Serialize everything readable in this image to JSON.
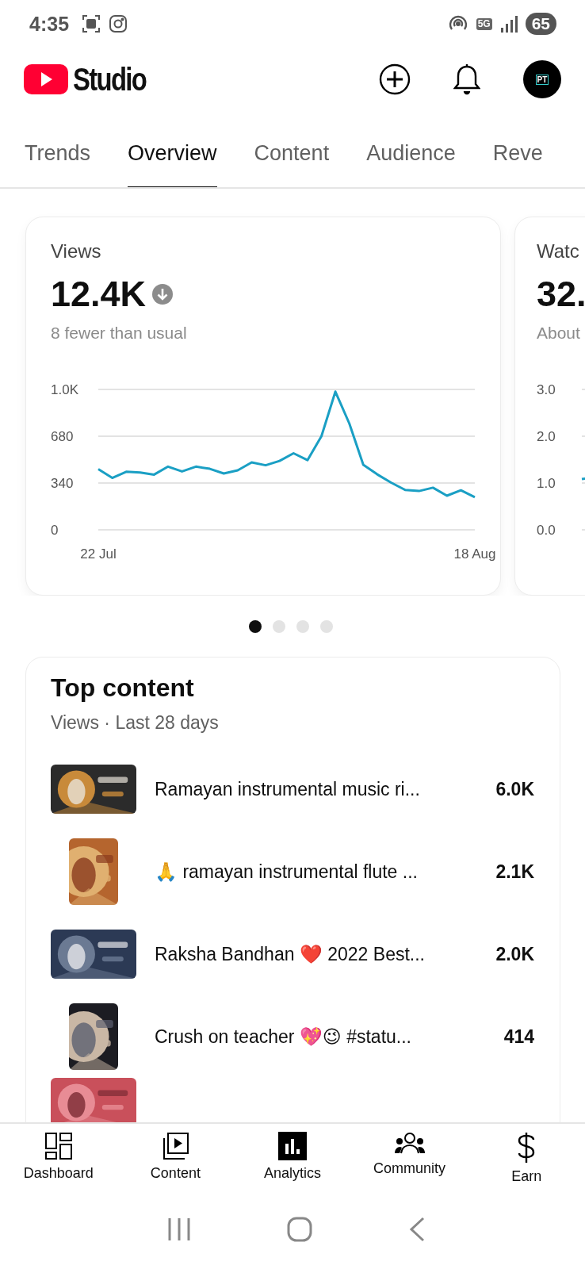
{
  "status_bar": {
    "time": "4:35",
    "network": "5G",
    "battery": "65"
  },
  "header": {
    "app_name": "Studio",
    "avatar_initials": "PT"
  },
  "tabs": [
    {
      "label": "Trends",
      "selected": false
    },
    {
      "label": "Overview",
      "selected": true
    },
    {
      "label": "Content",
      "selected": false
    },
    {
      "label": "Audience",
      "selected": false
    },
    {
      "label": "Reve",
      "selected": false
    }
  ],
  "metric_cards": [
    {
      "kind": "chart",
      "title": "Views",
      "value": "12.4K",
      "comparison": "8 fewer than usual",
      "chart_data": {
        "type": "line",
        "ylim": [
          0,
          1020
        ],
        "yticks": [
          0,
          340,
          680,
          {
            "value": 1020,
            "label": "1.0K"
          }
        ],
        "categories": [
          "22 Jul",
          null,
          null,
          null,
          null,
          null,
          null,
          null,
          null,
          null,
          null,
          null,
          null,
          null,
          null,
          null,
          null,
          null,
          null,
          null,
          null,
          null,
          null,
          null,
          null,
          null,
          null,
          "18 Aug"
        ],
        "series": [
          {
            "color": "#1a9fc4",
            "values": [
              440,
              377,
              422,
              416,
              401,
              459,
              424,
              459,
              443,
              409,
              432,
              490,
              469,
              501,
              556,
              506,
              680,
              1004,
              772,
              472,
              403,
              343,
              290,
              282,
              306,
              248,
              287,
              237
            ]
          }
        ]
      }
    },
    {
      "kind": "partial",
      "title": "Watc",
      "value": "32.",
      "comparison": "About",
      "axis_labels": [
        "3.0",
        "2.0",
        "1.0",
        "0.0"
      ]
    }
  ],
  "pager": {
    "dots": [
      {
        "selected": true
      },
      {
        "selected": false
      },
      {
        "selected": false
      },
      {
        "selected": false
      }
    ]
  },
  "top_content": {
    "title": "Top content",
    "subtitle": "Views · Last 28 days",
    "rows": [
      {
        "kind": "wide",
        "title": "Ramayan instrumental music ri...",
        "views": "6.0K"
      },
      {
        "kind": "tall",
        "title": "🙏 ramayan instrumental flute ...",
        "views": "2.1K"
      },
      {
        "kind": "wide",
        "title": "Raksha Bandhan ❤️ 2022 Best...",
        "views": "2.0K"
      },
      {
        "kind": "tall",
        "title": "Crush on teacher 💖😉 #statu...",
        "views": "414"
      },
      {
        "kind": "wide"
      }
    ]
  },
  "bottom_nav": {
    "items": [
      {
        "kind": "dashboard",
        "label": "Dashboard",
        "selected": false
      },
      {
        "kind": "content",
        "label": "Content",
        "selected": false
      },
      {
        "kind": "analytics",
        "label": "Analytics",
        "selected": true
      },
      {
        "kind": "community",
        "label": "Community",
        "selected": false
      },
      {
        "kind": "earn",
        "label": "Earn",
        "selected": false
      }
    ]
  }
}
